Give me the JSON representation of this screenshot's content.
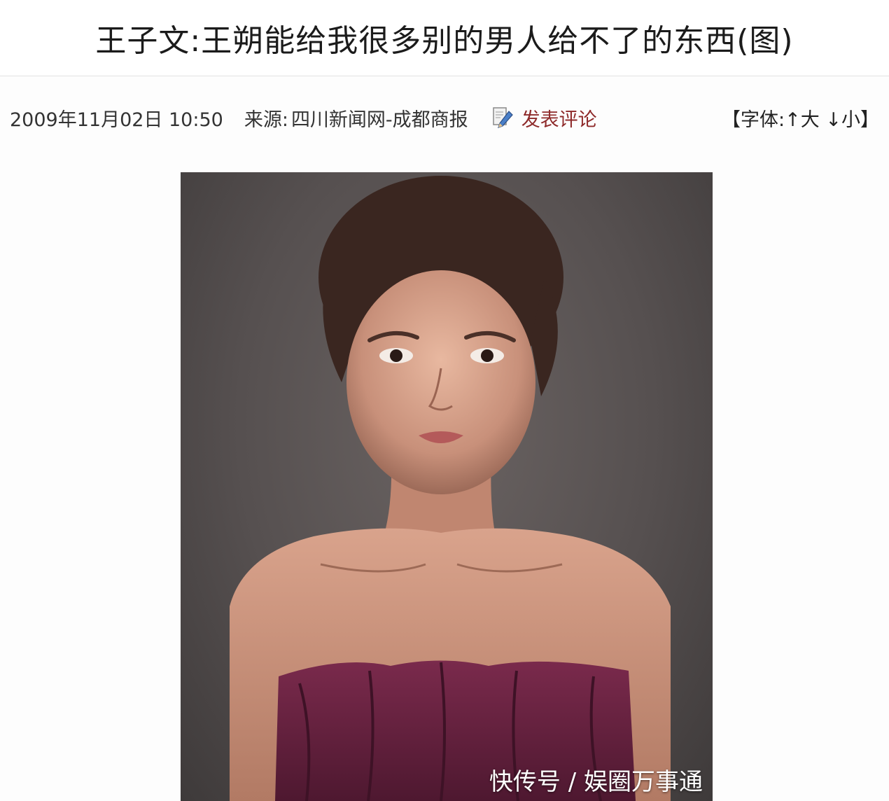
{
  "article": {
    "title": "王子文:王朔能给我很多别的男人给不了的东西(图)",
    "date": "2009年11月02日 10:50",
    "source_label": "来源:",
    "source": "四川新闻网-成都商报",
    "comment_link": "发表评论",
    "comment_icon": "pencil-icon",
    "font_size": {
      "open": "【字体:",
      "larger": "↑大",
      "smaller": "↓小",
      "close": "】"
    }
  },
  "photo": {
    "description_icon": "portrait-photo"
  },
  "watermark": {
    "text": "快传号 / 娱圈万事通"
  },
  "colors": {
    "comment_link": "#8e2a2a",
    "photo_background": "#5a5454",
    "dress": "#6b2341"
  }
}
